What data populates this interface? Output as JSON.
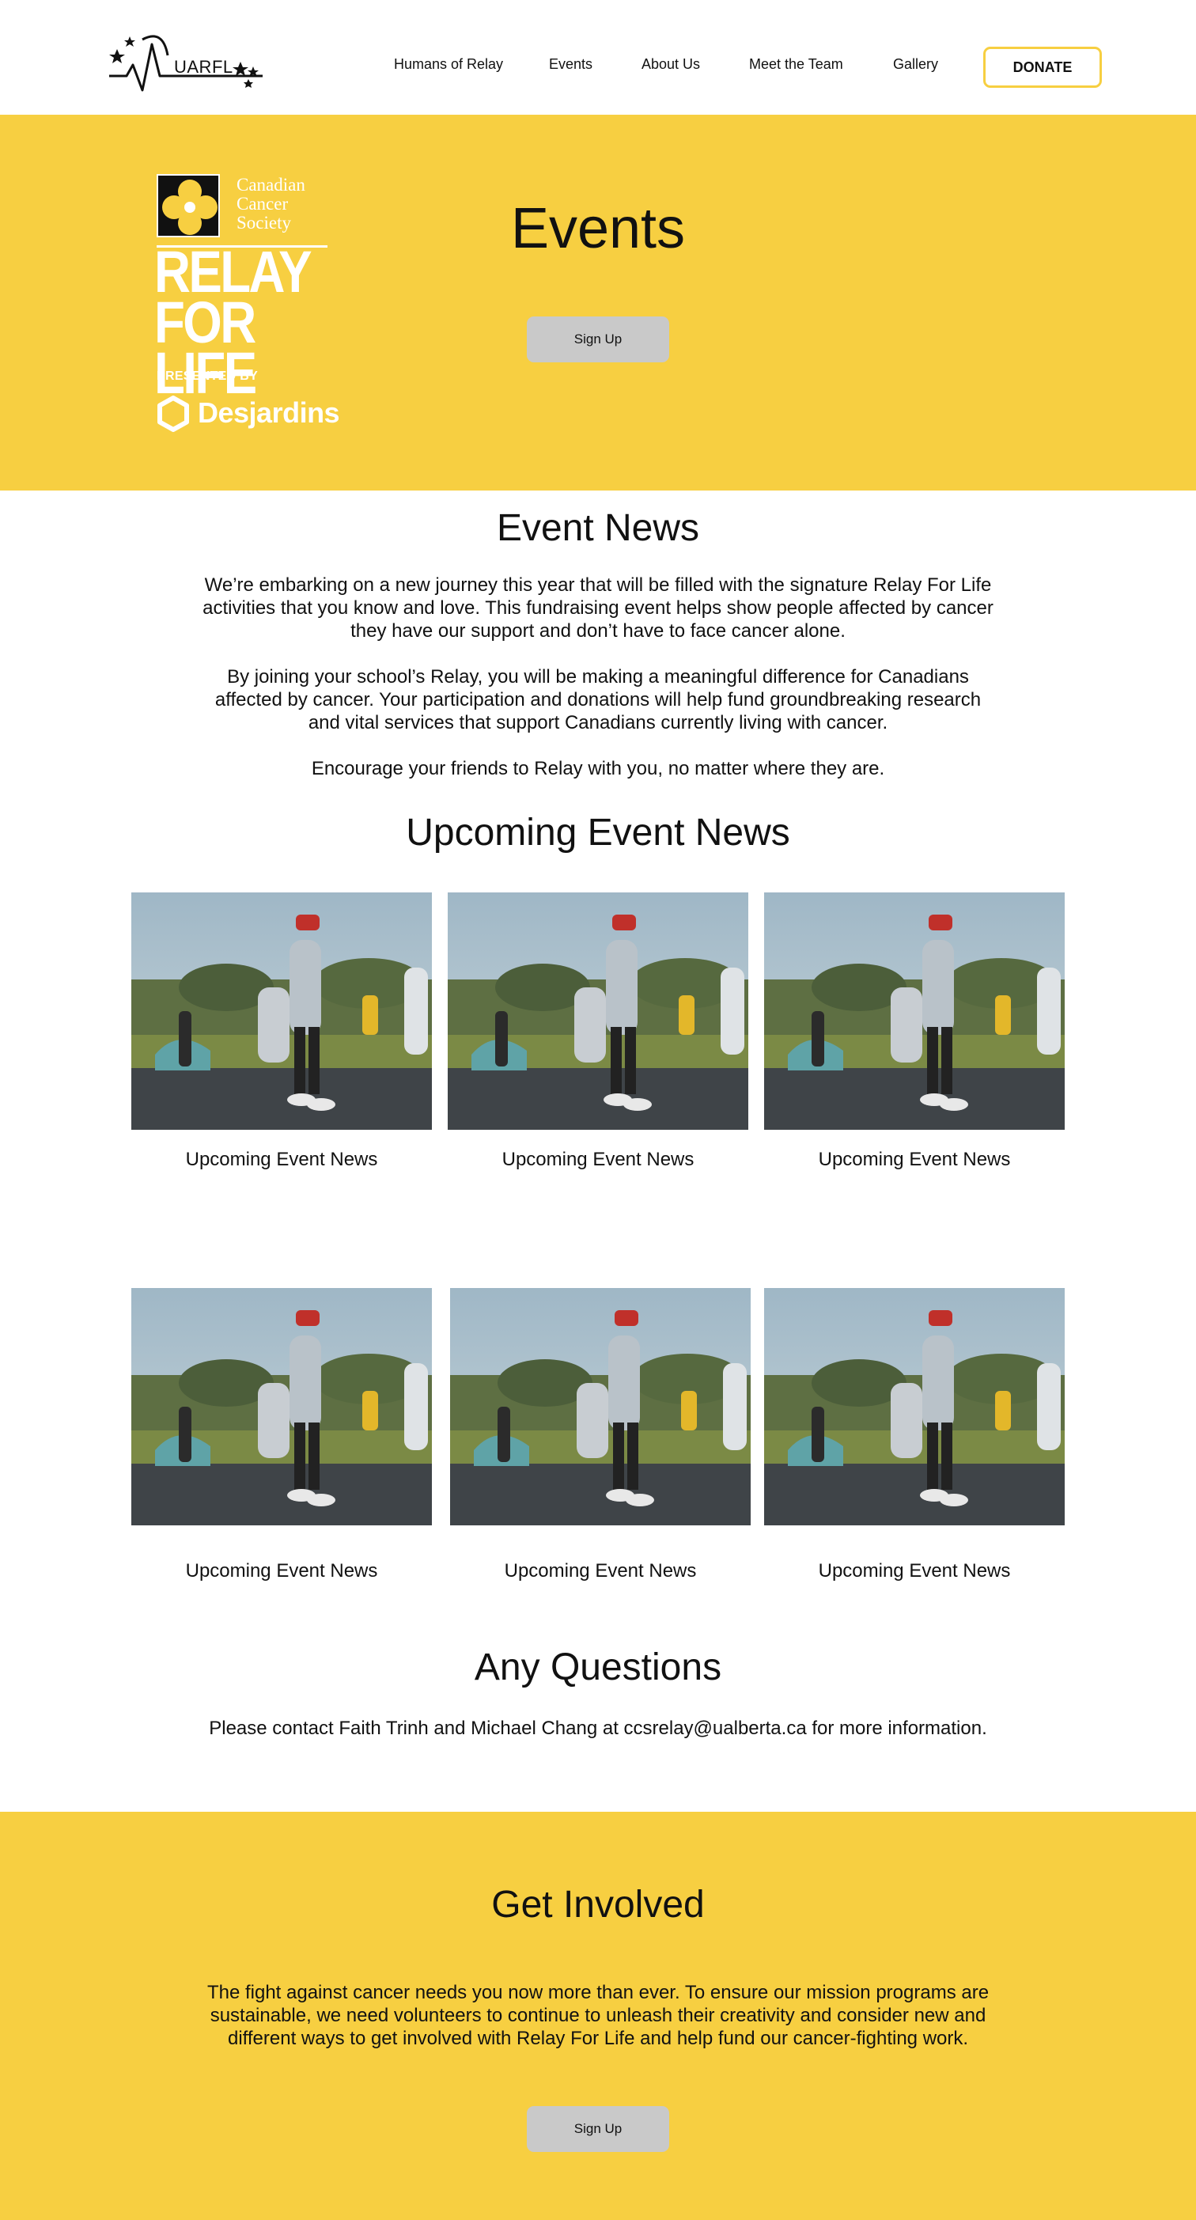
{
  "header": {
    "logo_text": "UARFL",
    "nav": [
      "Humans of Relay",
      "Events",
      "About Us",
      "Meet the Team",
      "Gallery"
    ],
    "donate_label": "DONATE"
  },
  "hero": {
    "logo": {
      "society_lines": [
        "Canadian",
        "Cancer",
        "Society"
      ],
      "title_lines": [
        "RELAY",
        "FOR LIFE"
      ],
      "presented_by": "PRESENTED BY",
      "sponsor": "Desjardins"
    },
    "title": "Events",
    "signup_label": "Sign Up"
  },
  "event_news": {
    "title": "Event News",
    "paragraphs": [
      "We’re embarking on a new journey this year that will be filled with the signature Relay For Life activities that you know and love. This fundraising event helps show people affected by cancer they have our support and don’t have to face cancer alone.",
      "By joining your school’s Relay, you will be making a meaningful difference for Canadians affected by cancer. Your participation and donations will help fund groundbreaking research and vital services that support Canadians currently living with cancer.",
      "Encourage your friends to Relay with you, no matter where they are."
    ]
  },
  "upcoming": {
    "title": "Upcoming Event News",
    "cards": [
      {
        "caption": "Upcoming Event News"
      },
      {
        "caption": "Upcoming Event News"
      },
      {
        "caption": "Upcoming Event News"
      },
      {
        "caption": "Upcoming Event News"
      },
      {
        "caption": "Upcoming Event News"
      },
      {
        "caption": "Upcoming Event News"
      }
    ]
  },
  "questions": {
    "title": "Any Questions",
    "text": "Please contact Faith Trinh and Michael Chang at ccsrelay@ualberta.ca for more information."
  },
  "get_involved": {
    "title": "Get Involved",
    "text": "The fight against cancer needs you now more than ever. To ensure our mission programs are sustainable, we need volunteers to continue to unleash their creativity and consider new and different ways to get involved with Relay For Life and help fund our cancer-fighting work.",
    "signup_label": "Sign Up"
  },
  "colors": {
    "brand_yellow": "#f7cf41",
    "button_grey": "#c9c9c9",
    "text": "#111111"
  },
  "icons": [
    "uarfl-logo-icon",
    "daffodil-icon",
    "desjardins-hexagon-icon"
  ]
}
